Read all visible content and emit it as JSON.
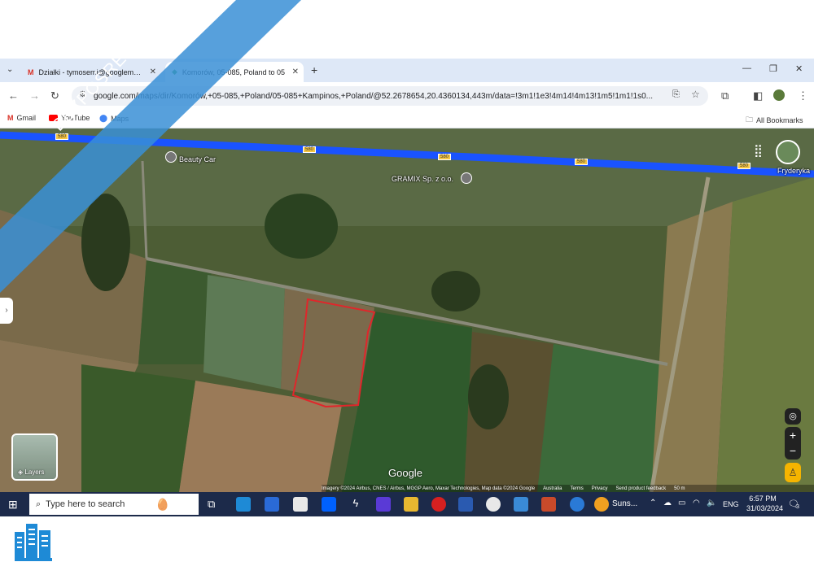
{
  "browser": {
    "tabs": [
      {
        "label": "Działki - tymosemi@googlemail.com",
        "icon": "gmail-icon"
      },
      {
        "label": "Komorów, 05-085, Poland to 05",
        "icon": "maps-icon"
      }
    ],
    "new_tab_label": "+",
    "url": "google.com/maps/dir/Komorów,+05-085,+Poland/05-085+Kampinos,+Poland/@52.2678654,20.4360134,443m/data=!3m1!1e3!4m14!4m13!1m5!1m1!1s0...",
    "bookmarks": [
      "Gmail",
      "YouTube",
      "Maps"
    ],
    "all_bookmarks_label": "All Bookmarks"
  },
  "map": {
    "route_number": "580",
    "places": [
      "Beauty Car",
      "GRAMIX Sp. z o.o.",
      "Fryderyka"
    ],
    "google_logo": "Google",
    "attribution": [
      "Imagery ©2024 Airbus, CNES / Airbus, MGGP Aero, Maxar Technologies, Map data ©2024 Google",
      "Australia",
      "Terms",
      "Privacy",
      "Send product feedback",
      "50 m"
    ],
    "layers_label": "Layers",
    "zoom_in": "+",
    "zoom_out": "−"
  },
  "taskbar": {
    "search_placeholder": "Type here to search",
    "weather": "Suns...",
    "language": "ENG",
    "time": "6:57 PM",
    "date": "31/03/2024",
    "notification_count": "3"
  },
  "watermark": {
    "banner_text": "BEZPOŚREDNIO",
    "banner_color": "#3a8fd6"
  },
  "colors": {
    "route": "#1a53ff",
    "parcel_outline": "#e0262b",
    "taskbar": "#1c2a4a"
  }
}
